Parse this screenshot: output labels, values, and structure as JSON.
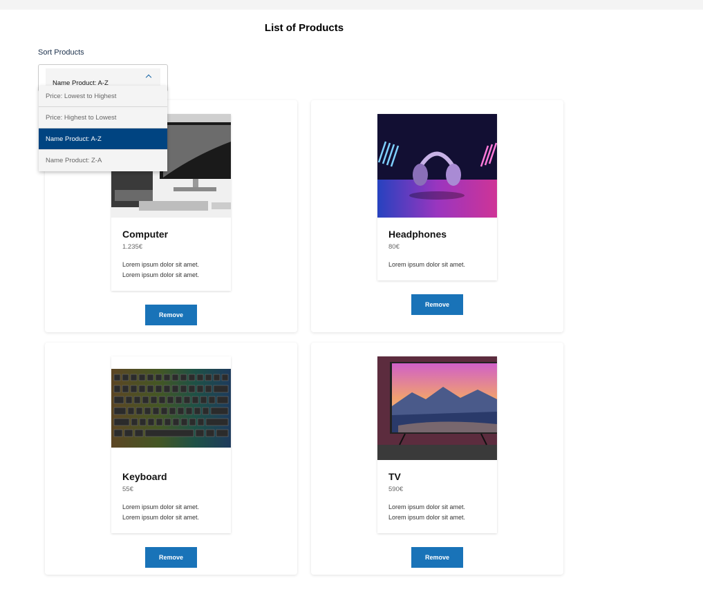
{
  "page": {
    "title": "List of Products"
  },
  "sort": {
    "label": "Sort Products",
    "selected": "Name Product: A-Z",
    "options": [
      {
        "label": "Price: Lowest to Highest",
        "active": false
      },
      {
        "label": "Price: Highest to Lowest",
        "active": false
      },
      {
        "label": "Name Product: A-Z",
        "active": true
      },
      {
        "label": "Name Product: Z-A",
        "active": false
      }
    ]
  },
  "products": [
    {
      "name": "Computer",
      "price": "1.235€",
      "desc1": "Lorem ipsum dolor sit amet.",
      "desc2": "Lorem ipsum dolor sit amet.",
      "remove": "Remove"
    },
    {
      "name": "Headphones",
      "price": "80€",
      "desc1": "Lorem ipsum dolor sit amet.",
      "desc2": "",
      "remove": "Remove"
    },
    {
      "name": "Keyboard",
      "price": "55€",
      "desc1": "Lorem ipsum dolor sit amet.",
      "desc2": "Lorem ipsum dolor sit amet.",
      "remove": "Remove"
    },
    {
      "name": "TV",
      "price": "590€",
      "desc1": "Lorem ipsum dolor sit amet.",
      "desc2": "Lorem ipsum dolor sit amet.",
      "remove": "Remove"
    }
  ],
  "colors": {
    "primary": "#1973b8",
    "selected": "#004481"
  }
}
